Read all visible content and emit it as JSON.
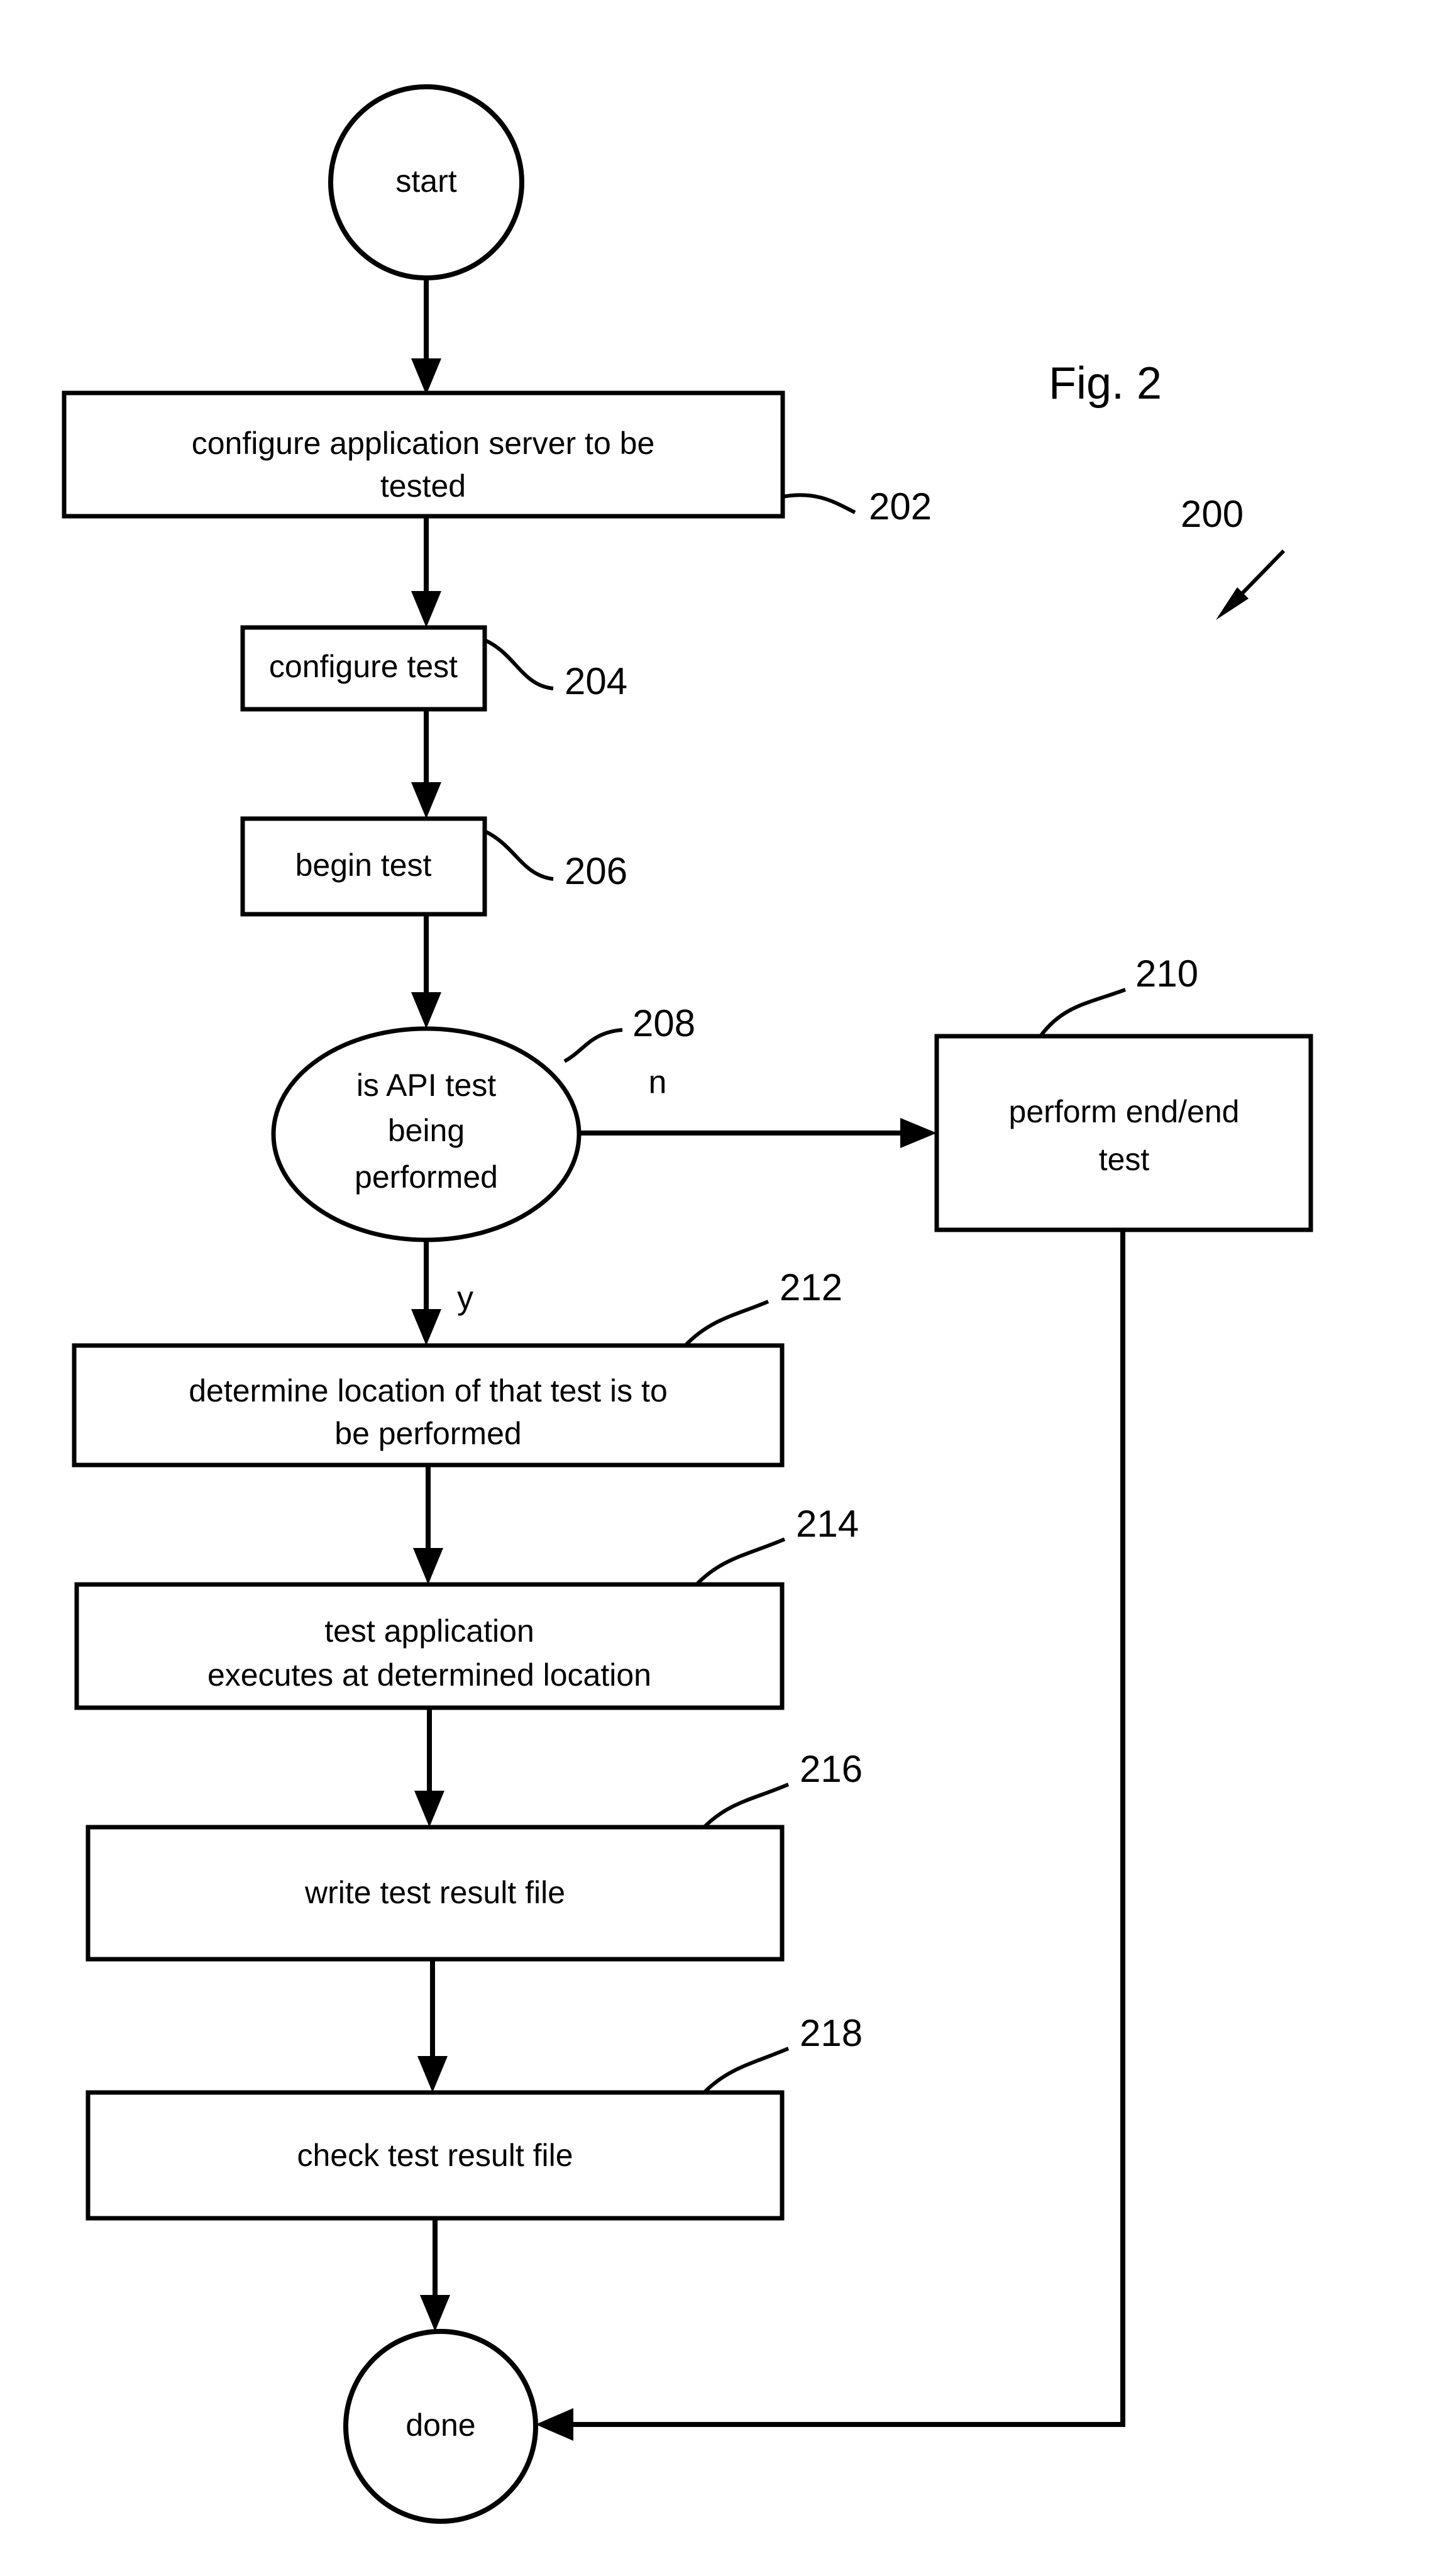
{
  "figure": {
    "caption": "Fig. 2",
    "diagram_ref": "200",
    "type": "flowchart"
  },
  "nodes": {
    "start": {
      "label": "start",
      "ref": ""
    },
    "configure_server": {
      "label_line1": "configure application server to be",
      "label_line2": "tested",
      "ref": "202"
    },
    "configure_test": {
      "label": "configure test",
      "ref": "204"
    },
    "begin_test": {
      "label": "begin test",
      "ref": "206"
    },
    "decision_api": {
      "label_line1": "is API test",
      "label_line2": "being",
      "label_line3": "performed",
      "ref": "208"
    },
    "perform_end_end": {
      "label_line1": "perform end/end",
      "label_line2": "test",
      "ref": "210"
    },
    "determine_location": {
      "label_line1": "determine location of that test is to",
      "label_line2": "be performed",
      "ref": "212"
    },
    "test_executes": {
      "label_line1": "test application",
      "label_line2": "executes at determined location",
      "ref": "214"
    },
    "write_result": {
      "label": "write test result file",
      "ref": "216"
    },
    "check_result": {
      "label": "check test result file",
      "ref": "218"
    },
    "done": {
      "label": "done",
      "ref": ""
    }
  },
  "branch_labels": {
    "no": "n",
    "yes": "y"
  },
  "colors": {
    "stroke": "#000000",
    "fill": "#ffffff",
    "text": "#000000"
  }
}
